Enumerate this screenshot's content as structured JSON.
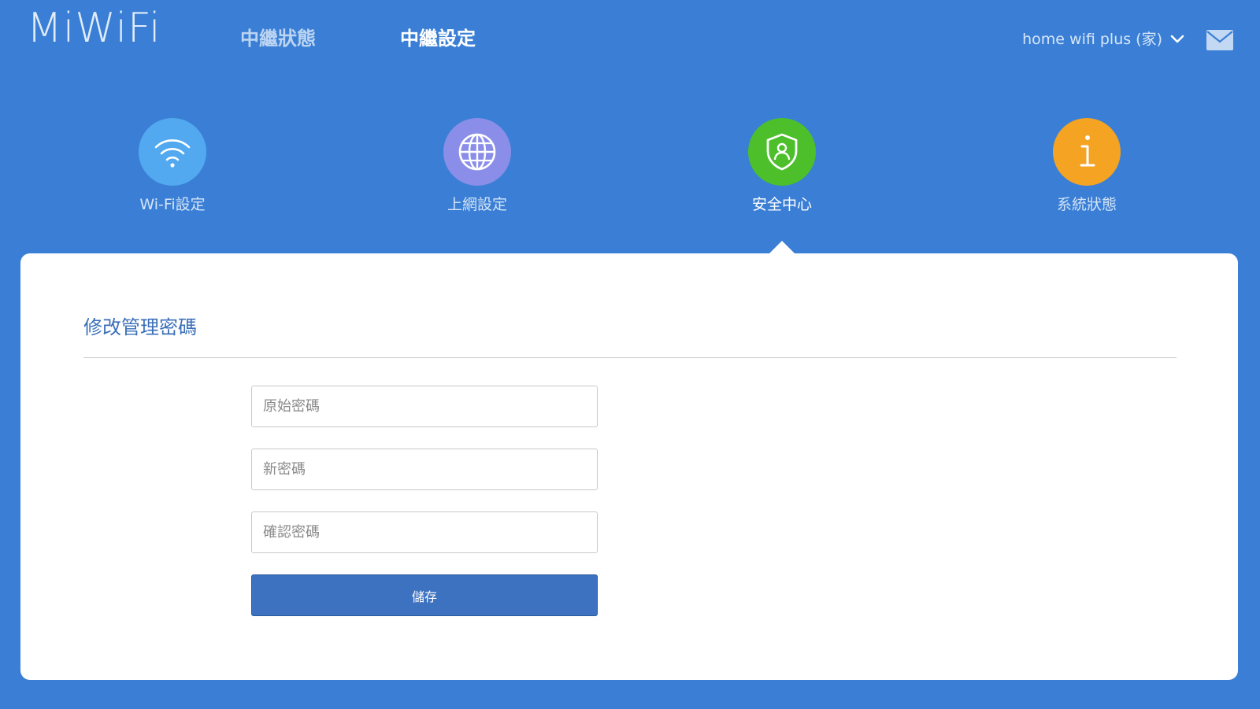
{
  "header": {
    "logo": "MiWiFi",
    "nav": [
      {
        "label": "中繼狀態"
      },
      {
        "label": "中繼設定"
      }
    ],
    "device_label": "home  wifi  plus (家)",
    "icons": {
      "dropdown": "chevron-down-icon",
      "mail": "mail-icon"
    }
  },
  "modules": [
    {
      "label": "Wi-Fi設定",
      "icon": "wifi-icon",
      "color": "#52a9ef"
    },
    {
      "label": "上網設定",
      "icon": "globe-icon",
      "color": "#8a8ee8"
    },
    {
      "label": "安全中心",
      "icon": "shield-user-icon",
      "color": "#4cbf2b"
    },
    {
      "label": "系統狀態",
      "icon": "info-icon",
      "color": "#f4a323"
    }
  ],
  "panel": {
    "title": "修改管理密碼",
    "fields": [
      {
        "placeholder": "原始密碼",
        "value": ""
      },
      {
        "placeholder": "新密碼",
        "value": ""
      },
      {
        "placeholder": "確認密碼",
        "value": ""
      }
    ],
    "save_label": "儲存"
  },
  "colors": {
    "background": "#3a7fd5",
    "panel": "#ffffff",
    "title": "#3a6fb8",
    "button": "#3c72c0"
  }
}
